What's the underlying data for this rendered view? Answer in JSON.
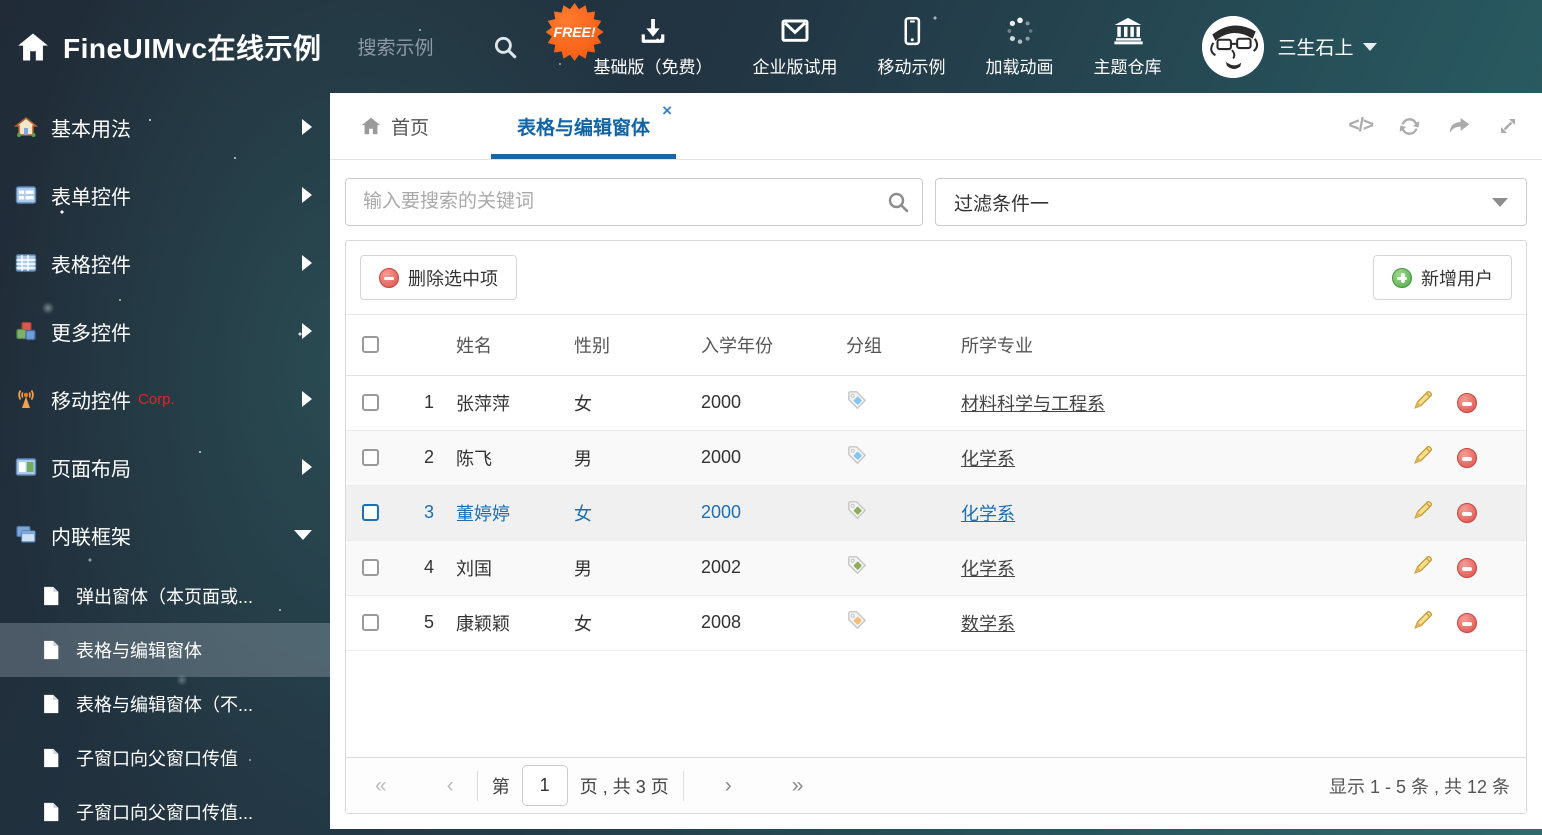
{
  "colors": {
    "accent_blue": "#1b67a5",
    "selected_text": "#1a6fb5",
    "free_badge_orange": "#f4550b",
    "tag_blue": "#85c5f0",
    "tag_green": "#8fae5a",
    "tag_orange": "#f7bb78",
    "delete_red": "#dd4f49",
    "add_green": "#4fab4c"
  },
  "header": {
    "title": "FineUIMvc在线示例",
    "search_placeholder": "搜索示例",
    "free_badge": "FREE!",
    "nav_items": [
      {
        "label": "基础版（免费）",
        "icon": "download-icon"
      },
      {
        "label": "企业版试用",
        "icon": "envelope-icon"
      },
      {
        "label": "移动示例",
        "icon": "mobile-icon"
      },
      {
        "label": "加载动画",
        "icon": "spinner-icon"
      },
      {
        "label": "主题仓库",
        "icon": "bank-icon"
      }
    ],
    "user_name": "三生石上"
  },
  "sidebar": {
    "groups": [
      {
        "label": "基本用法",
        "icon": "home-icon",
        "state": "collapsed"
      },
      {
        "label": "表单控件",
        "icon": "form-icon",
        "state": "collapsed"
      },
      {
        "label": "表格控件",
        "icon": "table-icon",
        "state": "collapsed"
      },
      {
        "label": "更多控件",
        "icon": "cubes-icon",
        "state": "collapsed"
      },
      {
        "label": "移动控件",
        "badge": "Corp.",
        "icon": "antenna-icon",
        "state": "collapsed"
      },
      {
        "label": "页面布局",
        "icon": "layout-icon",
        "state": "collapsed"
      },
      {
        "label": "内联框架",
        "icon": "frames-icon",
        "state": "expanded"
      }
    ],
    "subitems": [
      {
        "label": "弹出窗体（本页面或...",
        "selected": false
      },
      {
        "label": "表格与编辑窗体",
        "selected": true
      },
      {
        "label": "表格与编辑窗体（不...",
        "selected": false
      },
      {
        "label": "子窗口向父窗口传值",
        "selected": false
      },
      {
        "label": "子窗口向父窗口传值...",
        "selected": false
      }
    ]
  },
  "tabbar": {
    "home_tab": "首页",
    "active_tab": "表格与编辑窗体",
    "close_glyph": "×",
    "actions": [
      "code-icon",
      "refresh-icon",
      "share-icon",
      "expand-icon"
    ]
  },
  "filters": {
    "search_placeholder": "输入要搜索的关键词",
    "dropdown_value": "过滤条件一"
  },
  "toolbar": {
    "delete_label": "删除选中项",
    "add_label": "新增用户"
  },
  "table": {
    "headers": {
      "name": "姓名",
      "gender": "性别",
      "year": "入学年份",
      "group": "分组",
      "major": "所学专业"
    },
    "rows": [
      {
        "num": "1",
        "name": "张萍萍",
        "gender": "女",
        "year": "2000",
        "tag_color": "blue",
        "major": "材料科学与工程系",
        "selected": false
      },
      {
        "num": "2",
        "name": "陈飞",
        "gender": "男",
        "year": "2000",
        "tag_color": "blue",
        "major": "化学系",
        "selected": false
      },
      {
        "num": "3",
        "name": "董婷婷",
        "gender": "女",
        "year": "2000",
        "tag_color": "green",
        "major": "化学系",
        "selected": true
      },
      {
        "num": "4",
        "name": "刘国",
        "gender": "男",
        "year": "2002",
        "tag_color": "green",
        "major": "化学系",
        "selected": false
      },
      {
        "num": "5",
        "name": "康颖颖",
        "gender": "女",
        "year": "2008",
        "tag_color": "orange",
        "major": "数学系",
        "selected": false
      }
    ]
  },
  "pagination": {
    "first": "«",
    "prev": "‹",
    "next": "›",
    "last": "»",
    "page_label_prefix": "第",
    "page_value": "1",
    "page_label_suffix": "页 , 共 3 页",
    "summary": "显示 1 - 5 条 , 共 12 条"
  }
}
